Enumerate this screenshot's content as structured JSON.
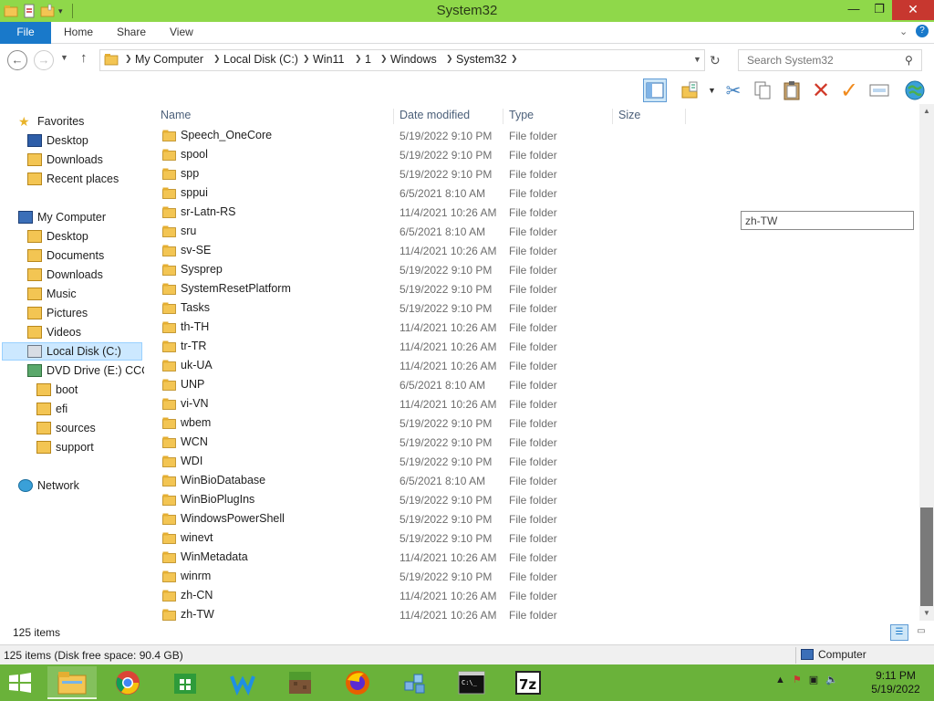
{
  "window": {
    "title": "System32"
  },
  "ribbon": {
    "tabs": [
      {
        "label": "File"
      },
      {
        "label": "Home"
      },
      {
        "label": "Share"
      },
      {
        "label": "View"
      }
    ]
  },
  "address": {
    "crumbs": [
      "My Computer",
      "Local Disk (C:)",
      "Win11",
      "1",
      "Windows",
      "System32"
    ]
  },
  "search": {
    "placeholder": "Search System32"
  },
  "nav": {
    "favorites": "Favorites",
    "fav_items": [
      "Desktop",
      "Downloads",
      "Recent places"
    ],
    "computer": "My Computer",
    "computer_items": [
      "Desktop",
      "Documents",
      "Downloads",
      "Music",
      "Pictures",
      "Videos",
      "Local Disk (C:)",
      "DVD Drive (E:) CCCC"
    ],
    "dvd_items": [
      "boot",
      "efi",
      "sources",
      "support"
    ],
    "network": "Network"
  },
  "columns": {
    "name": "Name",
    "date": "Date modified",
    "type": "Type",
    "size": "Size"
  },
  "files": [
    {
      "name": "Speech_OneCore",
      "date": "5/19/2022 9:10 PM",
      "type": "File folder"
    },
    {
      "name": "spool",
      "date": "5/19/2022 9:10 PM",
      "type": "File folder"
    },
    {
      "name": "spp",
      "date": "5/19/2022 9:10 PM",
      "type": "File folder"
    },
    {
      "name": "sppui",
      "date": "6/5/2021 8:10 AM",
      "type": "File folder"
    },
    {
      "name": "sr-Latn-RS",
      "date": "11/4/2021 10:26 AM",
      "type": "File folder"
    },
    {
      "name": "sru",
      "date": "6/5/2021 8:10 AM",
      "type": "File folder"
    },
    {
      "name": "sv-SE",
      "date": "11/4/2021 10:26 AM",
      "type": "File folder"
    },
    {
      "name": "Sysprep",
      "date": "5/19/2022 9:10 PM",
      "type": "File folder"
    },
    {
      "name": "SystemResetPlatform",
      "date": "5/19/2022 9:10 PM",
      "type": "File folder"
    },
    {
      "name": "Tasks",
      "date": "5/19/2022 9:10 PM",
      "type": "File folder"
    },
    {
      "name": "th-TH",
      "date": "11/4/2021 10:26 AM",
      "type": "File folder"
    },
    {
      "name": "tr-TR",
      "date": "11/4/2021 10:26 AM",
      "type": "File folder"
    },
    {
      "name": "uk-UA",
      "date": "11/4/2021 10:26 AM",
      "type": "File folder"
    },
    {
      "name": "UNP",
      "date": "6/5/2021 8:10 AM",
      "type": "File folder"
    },
    {
      "name": "vi-VN",
      "date": "11/4/2021 10:26 AM",
      "type": "File folder"
    },
    {
      "name": "wbem",
      "date": "5/19/2022 9:10 PM",
      "type": "File folder"
    },
    {
      "name": "WCN",
      "date": "5/19/2022 9:10 PM",
      "type": "File folder"
    },
    {
      "name": "WDI",
      "date": "5/19/2022 9:10 PM",
      "type": "File folder"
    },
    {
      "name": "WinBioDatabase",
      "date": "6/5/2021 8:10 AM",
      "type": "File folder"
    },
    {
      "name": "WinBioPlugIns",
      "date": "5/19/2022 9:10 PM",
      "type": "File folder"
    },
    {
      "name": "WindowsPowerShell",
      "date": "5/19/2022 9:10 PM",
      "type": "File folder"
    },
    {
      "name": "winevt",
      "date": "5/19/2022 9:10 PM",
      "type": "File folder"
    },
    {
      "name": "WinMetadata",
      "date": "11/4/2021 10:26 AM",
      "type": "File folder"
    },
    {
      "name": "winrm",
      "date": "5/19/2022 9:10 PM",
      "type": "File folder"
    },
    {
      "name": "zh-CN",
      "date": "11/4/2021 10:26 AM",
      "type": "File folder"
    },
    {
      "name": "zh-TW",
      "date": "11/4/2021 10:26 AM",
      "type": "File folder"
    }
  ],
  "floating_label": "zh-TW",
  "status": {
    "item_count": "125 items",
    "disk_info": "125 items (Disk free space: 90.4 GB)",
    "computer": "Computer"
  },
  "clock": {
    "time": "9:11 PM",
    "date": "5/19/2022"
  },
  "colors": {
    "titlebar": "#8fd84a",
    "taskbar": "#6ab23a",
    "accent": "#1979ca",
    "close": "#c7372f",
    "folder": "#e8b94a"
  }
}
